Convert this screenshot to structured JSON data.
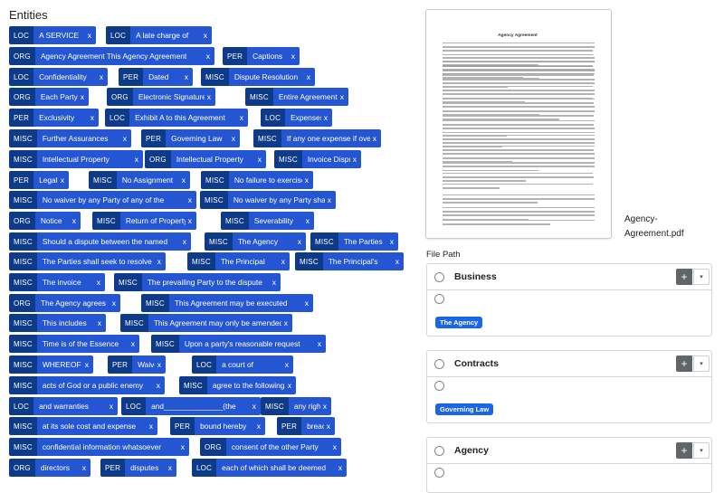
{
  "entities": {
    "title": "Entities",
    "items": [
      {
        "type": "LOC",
        "text": "A SERVICE",
        "x": "x"
      },
      {
        "type": "LOC",
        "text": "A late charge of",
        "x": "x"
      },
      {
        "type": "ORG",
        "text": "Agency Agreement This Agency Agreement",
        "x": "x"
      },
      {
        "type": "PER",
        "text": "Captions",
        "x": "x"
      },
      {
        "type": "LOC",
        "text": "Confidentiality",
        "x": "x"
      },
      {
        "type": "PER",
        "text": "Dated",
        "x": "x"
      },
      {
        "type": "MISC",
        "text": "Dispute Resolution",
        "x": "x"
      },
      {
        "type": "ORG",
        "text": "Each Party",
        "x": "x"
      },
      {
        "type": "ORG",
        "text": "Electronic Signatures",
        "x": "x"
      },
      {
        "type": "MISC",
        "text": "Entire Agreement",
        "x": "x"
      },
      {
        "type": "PER",
        "text": "Exclusivity",
        "x": "x"
      },
      {
        "type": "LOC",
        "text": "Exhibit A to this Agreement",
        "x": "x"
      },
      {
        "type": "LOC",
        "text": "Expenses",
        "x": "x"
      },
      {
        "type": "MISC",
        "text": "Further Assurances",
        "x": "x"
      },
      {
        "type": "PER",
        "text": "Governing Law",
        "x": "x"
      },
      {
        "type": "MISC",
        "text": "If any one expense if over $",
        "x": "x"
      },
      {
        "type": "MISC",
        "text": "Intellectual Property",
        "x": "x"
      },
      {
        "type": "ORG",
        "text": "Intellectual Property",
        "x": "x"
      },
      {
        "type": "MISC",
        "text": "Invoice Disputes",
        "x": "x"
      },
      {
        "type": "PER",
        "text": "Legal",
        "x": "x"
      },
      {
        "type": "MISC",
        "text": "No Assignment",
        "x": "x"
      },
      {
        "type": "MISC",
        "text": "No failure to exercise",
        "x": "x"
      },
      {
        "type": "MISC",
        "text": "No waiver by any Party of any of the",
        "x": "x"
      },
      {
        "type": "MISC",
        "text": "No waiver by any Party shall",
        "x": "x"
      },
      {
        "type": "ORG",
        "text": "Notice",
        "x": "x"
      },
      {
        "type": "MISC",
        "text": "Return of Property",
        "x": "x"
      },
      {
        "type": "MISC",
        "text": "Severability",
        "x": "x"
      },
      {
        "type": "MISC",
        "text": "Should a dispute between the named",
        "x": "x"
      },
      {
        "type": "MISC",
        "text": "The Agency",
        "x": "x"
      },
      {
        "type": "MISC",
        "text": "The Parties",
        "x": "x"
      },
      {
        "type": "MISC",
        "text": "The Parties shall seek to resolve",
        "x": "x"
      },
      {
        "type": "MISC",
        "text": "The Principal",
        "x": "x"
      },
      {
        "type": "MISC",
        "text": "The Principal's",
        "x": "x"
      },
      {
        "type": "MISC",
        "text": "The invoice",
        "x": "x"
      },
      {
        "type": "MISC",
        "text": "The prevailing Party to the dispute",
        "x": "x"
      },
      {
        "type": "ORG",
        "text": "The Agency agrees",
        "x": "x"
      },
      {
        "type": "MISC",
        "text": "This Agreement may be executed",
        "x": "x"
      },
      {
        "type": "MISC",
        "text": "This includes",
        "x": "x"
      },
      {
        "type": "MISC",
        "text": "This Agreement may only be amended",
        "x": "x"
      },
      {
        "type": "MISC",
        "text": "Time is of the Essence",
        "x": "x"
      },
      {
        "type": "MISC",
        "text": "Upon a party's reasonable request",
        "x": "x"
      },
      {
        "type": "MISC",
        "text": "WHEREOF",
        "x": "x"
      },
      {
        "type": "PER",
        "text": "Waiver",
        "x": "x"
      },
      {
        "type": "LOC",
        "text": "a court of",
        "x": "x"
      },
      {
        "type": "MISC",
        "text": "acts of God or a public enemy",
        "x": "x"
      },
      {
        "type": "MISC",
        "text": "agree to the following",
        "x": "x"
      },
      {
        "type": "LOC",
        "text": "and warranties",
        "x": "x"
      },
      {
        "type": "LOC",
        "text": "and______________(the",
        "x": "x"
      },
      {
        "type": "MISC",
        "text": "any right",
        "x": "x"
      },
      {
        "type": "MISC",
        "text": "at its sole cost and expense",
        "x": "x"
      },
      {
        "type": "PER",
        "text": "bound hereby",
        "x": "x"
      },
      {
        "type": "PER",
        "text": "breach",
        "x": "x"
      },
      {
        "type": "MISC",
        "text": "confidential information whatsoever",
        "x": "x"
      },
      {
        "type": "ORG",
        "text": "consent of the other Party",
        "x": "x"
      },
      {
        "type": "ORG",
        "text": "directors",
        "x": "x"
      },
      {
        "type": "PER",
        "text": "disputes",
        "x": "x"
      },
      {
        "type": "LOC",
        "text": "each of which shall be deemed",
        "x": "x"
      }
    ]
  },
  "preview": {
    "doc_title": "Agency Agreement",
    "file_name": "Agency-Agreement.pdf"
  },
  "file_path": {
    "label": "File Path",
    "folders": [
      {
        "name": "Business",
        "badge": "The Agency",
        "plus": "+",
        "caret": "▾"
      },
      {
        "name": "Contracts",
        "badge": "Governing Law",
        "plus": "+",
        "caret": "▾"
      },
      {
        "name": "Agency",
        "badge": "",
        "plus": "+",
        "caret": "▾"
      }
    ]
  },
  "colors": {
    "tag_bg": "#0e3a8a",
    "chip_bg": "#2456d3",
    "badge_bg": "#1b66e8",
    "button_bg": "#5f6569"
  }
}
